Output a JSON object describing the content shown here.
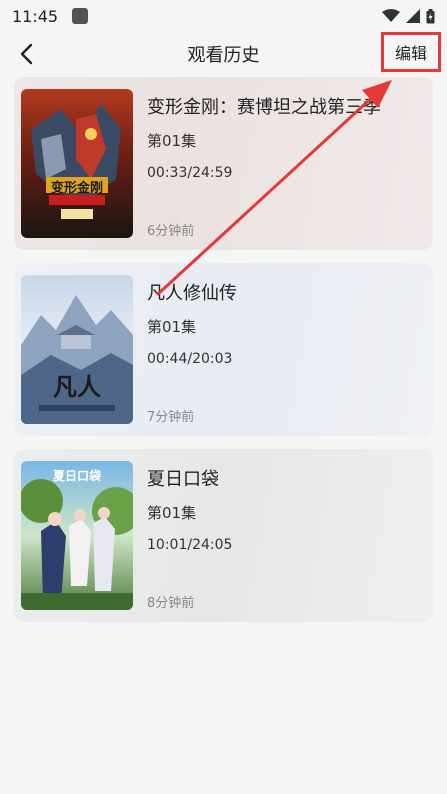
{
  "status_bar": {
    "time": "11:45"
  },
  "header": {
    "title": "观看历史",
    "edit_label": "编辑"
  },
  "history": [
    {
      "title": "变形金刚：赛博坦之战第三季",
      "episode": "第01集",
      "progress": "00:33/24:59",
      "time_ago": "6分钟前",
      "cover_text": "变形金刚"
    },
    {
      "title": "凡人修仙传",
      "episode": "第01集",
      "progress": "00:44/20:03",
      "time_ago": "7分钟前",
      "cover_text": "凡人"
    },
    {
      "title": "夏日口袋",
      "episode": "第01集",
      "progress": "10:01/24:05",
      "time_ago": "8分钟前",
      "cover_text": "夏日口袋"
    }
  ],
  "colors": {
    "annotation": "#e53935"
  }
}
